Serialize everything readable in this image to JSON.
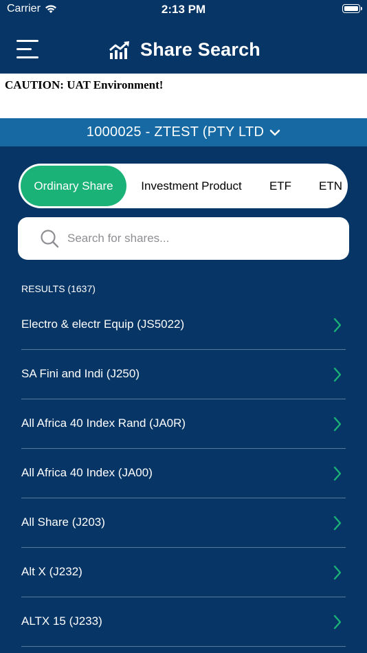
{
  "status_bar": {
    "carrier": "Carrier",
    "time": "2:13 PM"
  },
  "nav": {
    "title": "Share Search",
    "menu_icon": "hamburger-menu-icon",
    "title_icon": "trending-chart-icon"
  },
  "caution": {
    "text": "CAUTION: UAT Environment!"
  },
  "account": {
    "label": "1000025 - ZTEST (PTY LTD",
    "icon": "chevron-down-icon"
  },
  "tabs": [
    {
      "label": "Ordinary Share",
      "active": true
    },
    {
      "label": "Investment Product",
      "active": false
    },
    {
      "label": "ETF",
      "active": false
    },
    {
      "label": "ETN",
      "active": false
    }
  ],
  "search": {
    "placeholder": "Search for shares...",
    "value": ""
  },
  "results": {
    "header": "RESULTS (1637)",
    "items": [
      {
        "label": "Electro & electr Equip (JS5022)"
      },
      {
        "label": "SA Fini and Indi (J250)"
      },
      {
        "label": "All Africa 40 Index Rand (JA0R)"
      },
      {
        "label": "All Africa 40 Index (JA00)"
      },
      {
        "label": "All Share (J203)"
      },
      {
        "label": "Alt X (J232)"
      },
      {
        "label": "ALTX 15 (J233)"
      }
    ]
  },
  "colors": {
    "background": "#063566",
    "account_bar": "#1669a3",
    "accent_green": "#1ab276"
  }
}
